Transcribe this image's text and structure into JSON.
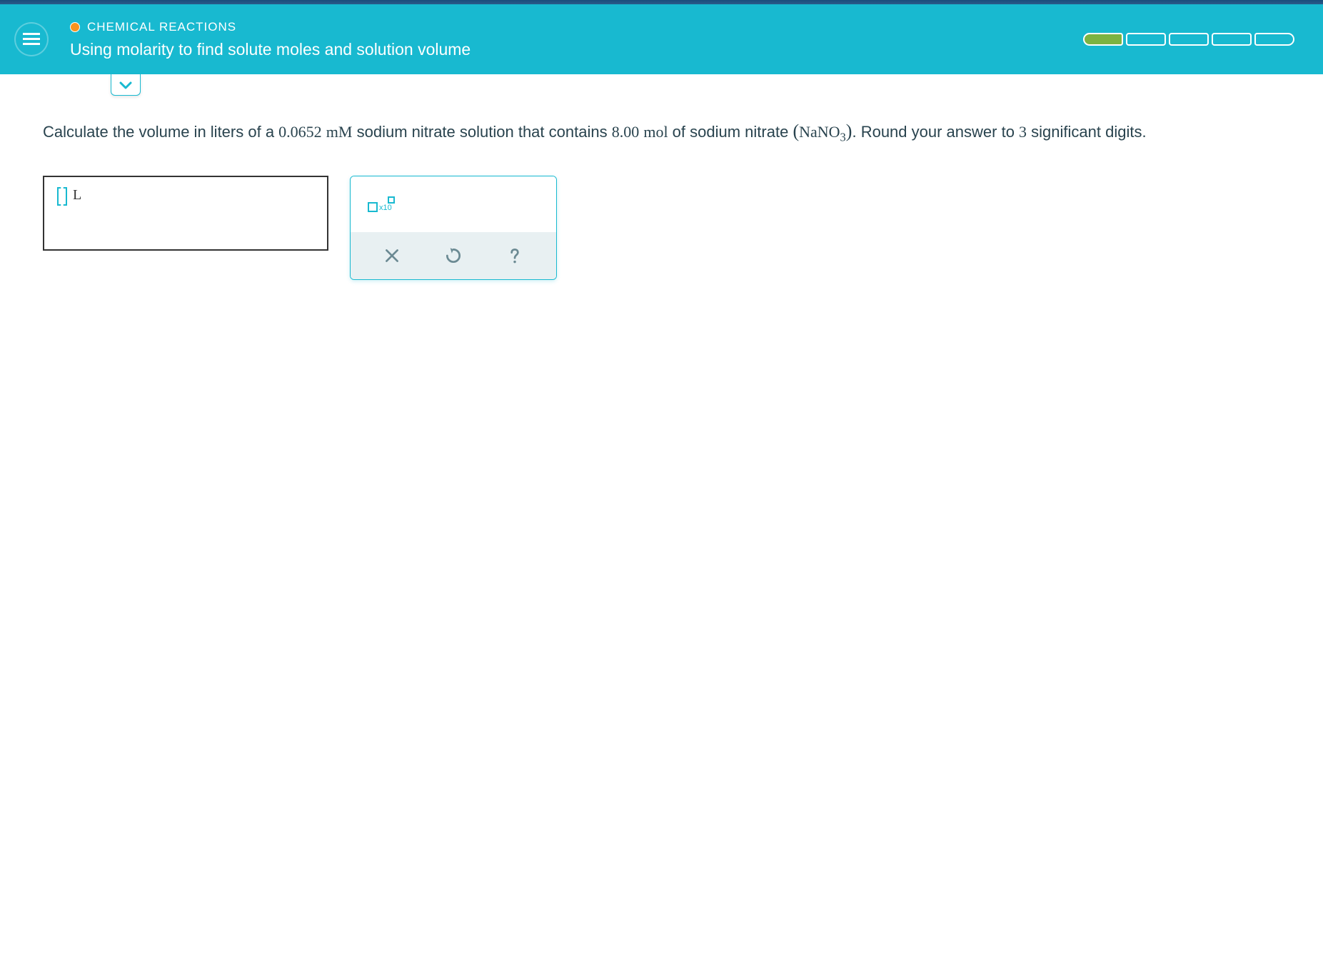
{
  "header": {
    "category": "CHEMICAL REACTIONS",
    "title": "Using molarity to find solute moles and solution volume"
  },
  "question": {
    "pre": "Calculate the volume in liters of a ",
    "value1": "0.0652",
    "unit1": "mM",
    "mid1": " sodium nitrate solution that contains ",
    "value2": "8.00",
    "unit2": "mol",
    "mid2": " of sodium nitrate ",
    "formula_open": "(",
    "formula": "NaNO",
    "formula_sub": "3",
    "formula_close": ")",
    "post": ". Round your answer to ",
    "sigdig": "3",
    "post2": " significant digits."
  },
  "answer": {
    "unit": "L"
  },
  "tools": {
    "x10": "x10"
  }
}
